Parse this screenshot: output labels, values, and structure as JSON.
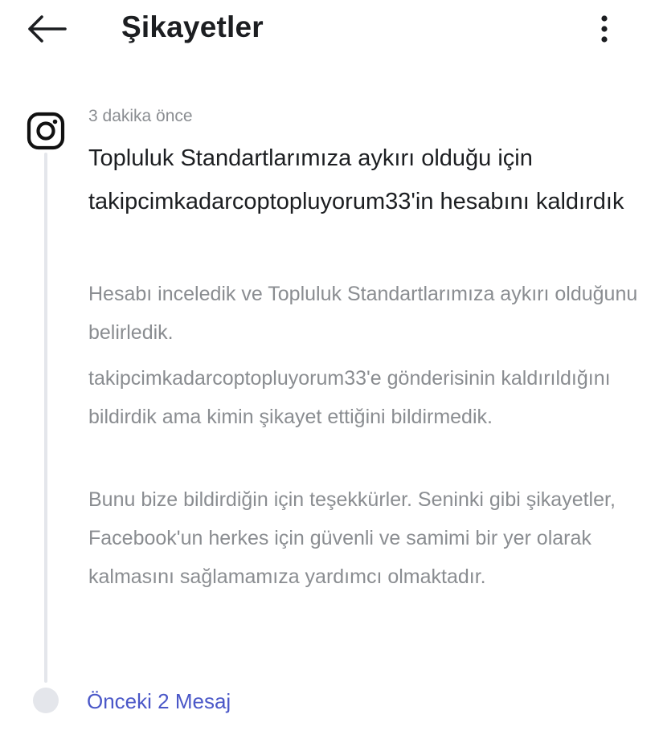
{
  "header": {
    "title": "Şikayetler",
    "back_icon": "arrow-left-icon",
    "menu_icon": "more-vertical-icon"
  },
  "notification": {
    "app_icon": "instagram-icon",
    "timestamp": "3 dakika önce",
    "title": "Topluluk Standartlarımıza aykırı olduğu için takipcimkadarcoptopluyorum33'in hesabını kaldırdık",
    "paragraphs": [
      "Hesabı inceledik ve Topluluk Standartlarımıza aykırı olduğunu belirledik.",
      "takipcimkadarcoptopluyorum33'e gönderisinin kaldırıldığını bildirdik ama kimin şikayet ettiğini bildirmedik.",
      "Bunu bize bildirdiğin için teşekkürler. Seninki gibi şikayetler, Facebook'un herkes için güvenli ve samimi bir yer olarak kalmasını sağlamamıza yardımcı olmaktadır."
    ]
  },
  "footer": {
    "previous_messages_label": "Önceki 2 Mesaj"
  },
  "colors": {
    "primary_text": "#1c1e21",
    "secondary_text": "#8a8d91",
    "link": "#4a57c8",
    "timeline": "#e4e6eb"
  }
}
